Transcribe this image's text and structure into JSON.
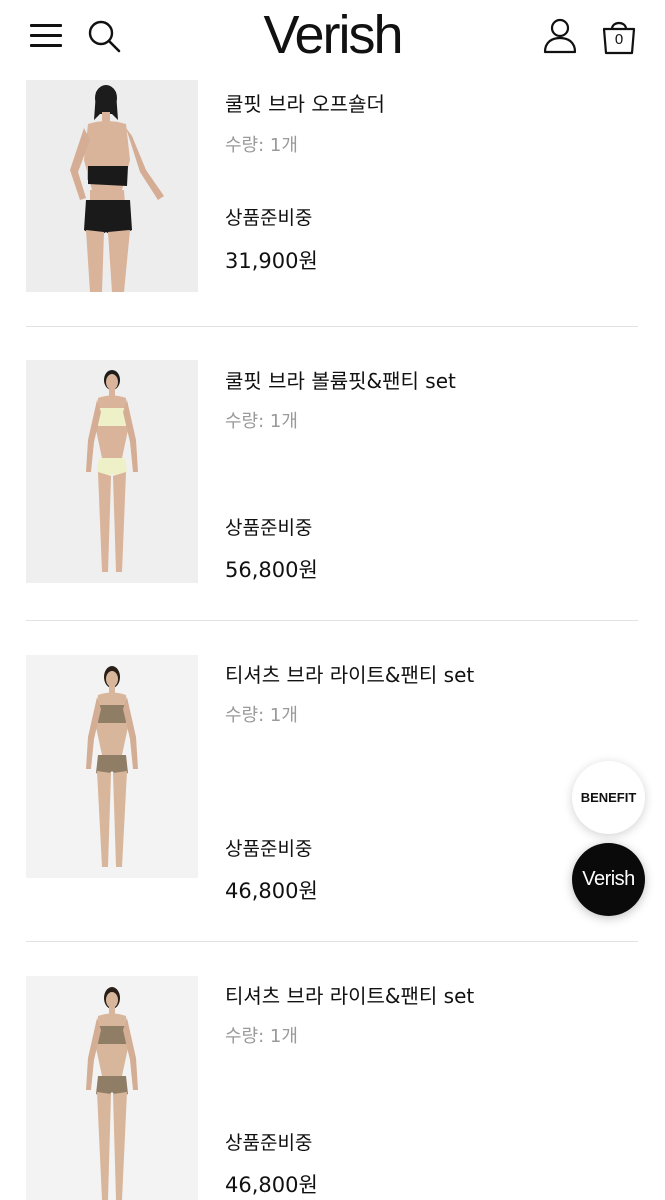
{
  "header": {
    "logo": "Verish",
    "cart_count": "0"
  },
  "products": [
    {
      "name": "쿨핏 브라 오프숄더",
      "quantity": "수량: 1개",
      "status": "상품준비중",
      "price": "31,900원",
      "garment_color": "#1a1a1a"
    },
    {
      "name": "쿨핏 브라 볼륨핏&팬티 set",
      "quantity": "수량: 1개",
      "status": "상품준비중",
      "price": "56,800원",
      "garment_color": "#eef0c8"
    },
    {
      "name": "티셔츠 브라 라이트&팬티 set",
      "quantity": "수량: 1개",
      "status": "상품준비중",
      "price": "46,800원",
      "garment_color": "#8f7d66"
    },
    {
      "name": "티셔츠 브라 라이트&팬티 set",
      "quantity": "수량: 1개",
      "status": "상품준비중",
      "price": "46,800원",
      "garment_color": "#8f7d66"
    }
  ],
  "floating": {
    "benefit_label": "BENEFIT",
    "verish_label": "Verish"
  }
}
